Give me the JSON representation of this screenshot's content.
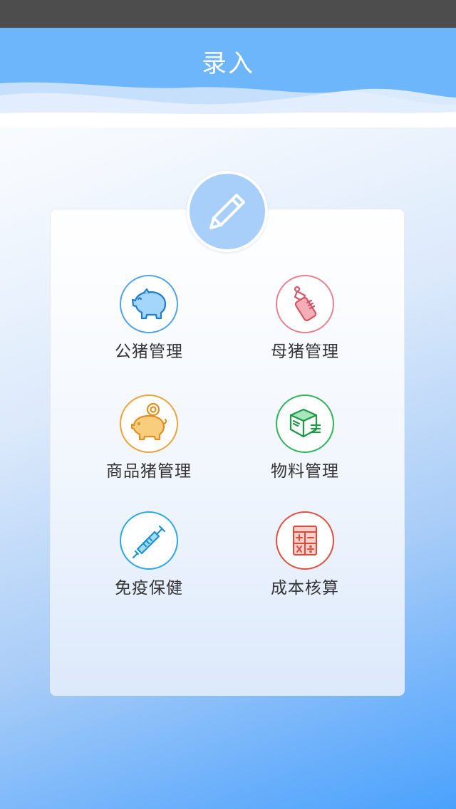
{
  "header": {
    "title": "录入",
    "background_color": "#6db6fb"
  },
  "badge": {
    "icon": "pencil-icon",
    "color": "#a8cffa"
  },
  "menu": {
    "items": [
      {
        "label": "公猪管理",
        "icon": "boar-pig-icon",
        "color": "#4ea3e9"
      },
      {
        "label": "母猪管理",
        "icon": "baby-bottle-icon",
        "color": "#e8828e"
      },
      {
        "label": "商品猪管理",
        "icon": "piggy-bank-icon",
        "color": "#eba33a"
      },
      {
        "label": "物料管理",
        "icon": "package-box-icon",
        "color": "#2fb559"
      },
      {
        "label": "免疫保健",
        "icon": "syringe-icon",
        "color": "#2aa9e4"
      },
      {
        "label": "成本核算",
        "icon": "calculator-icon",
        "color": "#e3503f"
      }
    ]
  }
}
